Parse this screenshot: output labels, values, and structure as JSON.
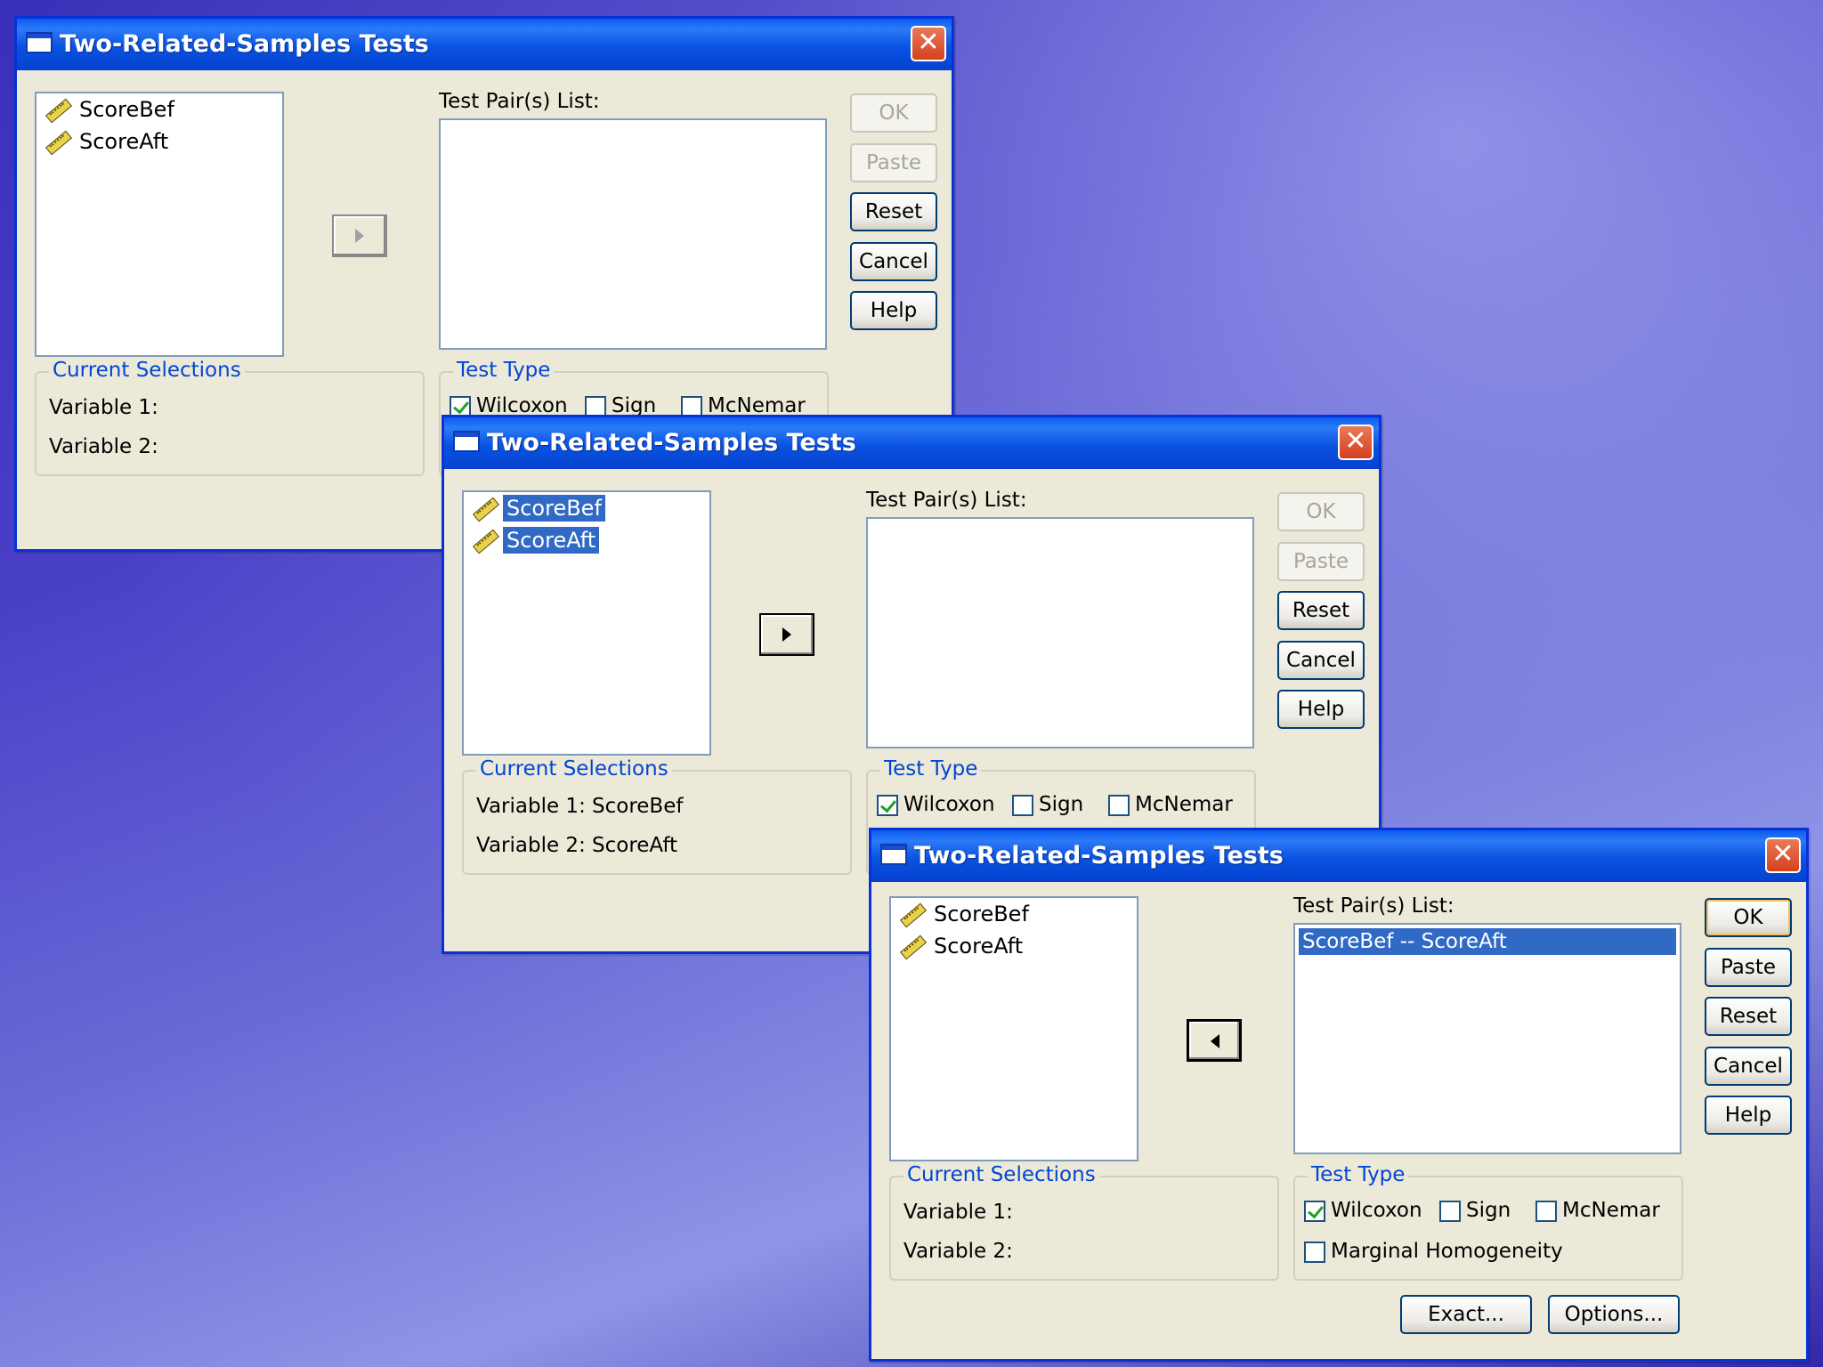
{
  "dialogs": [
    {
      "title": "Two-Related-Samples Tests",
      "variables": [
        "ScoreBef",
        "ScoreAft"
      ],
      "pairs_label": "Test Pair(s) List:",
      "pairs": [],
      "buttons": {
        "ok": "OK",
        "paste": "Paste",
        "reset": "Reset",
        "cancel": "Cancel",
        "help": "Help"
      },
      "current_selections": {
        "title": "Current Selections",
        "var1_label": "Variable 1:",
        "var1_value": "",
        "var2_label": "Variable 2:",
        "var2_value": ""
      },
      "test_type": {
        "title": "Test Type",
        "wilcoxon": "Wilcoxon",
        "sign": "Sign",
        "mcnemar": "McNemar"
      }
    },
    {
      "title": "Two-Related-Samples Tests",
      "variables": [
        "ScoreBef",
        "ScoreAft"
      ],
      "pairs_label": "Test Pair(s) List:",
      "pairs": [],
      "buttons": {
        "ok": "OK",
        "paste": "Paste",
        "reset": "Reset",
        "cancel": "Cancel",
        "help": "Help"
      },
      "current_selections": {
        "title": "Current Selections",
        "var1_label": "Variable 1:",
        "var1_value": "ScoreBef",
        "var2_label": "Variable 2:",
        "var2_value": "ScoreAft"
      },
      "test_type": {
        "title": "Test Type",
        "wilcoxon": "Wilcoxon",
        "sign": "Sign",
        "mcnemar": "McNemar"
      }
    },
    {
      "title": "Two-Related-Samples Tests",
      "variables": [
        "ScoreBef",
        "ScoreAft"
      ],
      "pairs_label": "Test Pair(s) List:",
      "pairs": [
        "ScoreBef -- ScoreAft"
      ],
      "buttons": {
        "ok": "OK",
        "paste": "Paste",
        "reset": "Reset",
        "cancel": "Cancel",
        "help": "Help",
        "exact": "Exact...",
        "options": "Options..."
      },
      "current_selections": {
        "title": "Current Selections",
        "var1_label": "Variable 1:",
        "var1_value": "",
        "var2_label": "Variable 2:",
        "var2_value": ""
      },
      "test_type": {
        "title": "Test Type",
        "wilcoxon": "Wilcoxon",
        "sign": "Sign",
        "mcnemar": "McNemar",
        "marginal": "Marginal Homogeneity"
      }
    }
  ],
  "icons": {
    "close": "close-icon",
    "variable": "ruler-icon",
    "window": "window-icon",
    "arrow": "arrow-icon"
  },
  "colors": {
    "titlebar": "#0a52e0",
    "selection": "#316ac5",
    "group_title": "#0046d5",
    "dialog_bg": "#ece9d8",
    "check": "#21a121",
    "close": "#d6401e"
  }
}
